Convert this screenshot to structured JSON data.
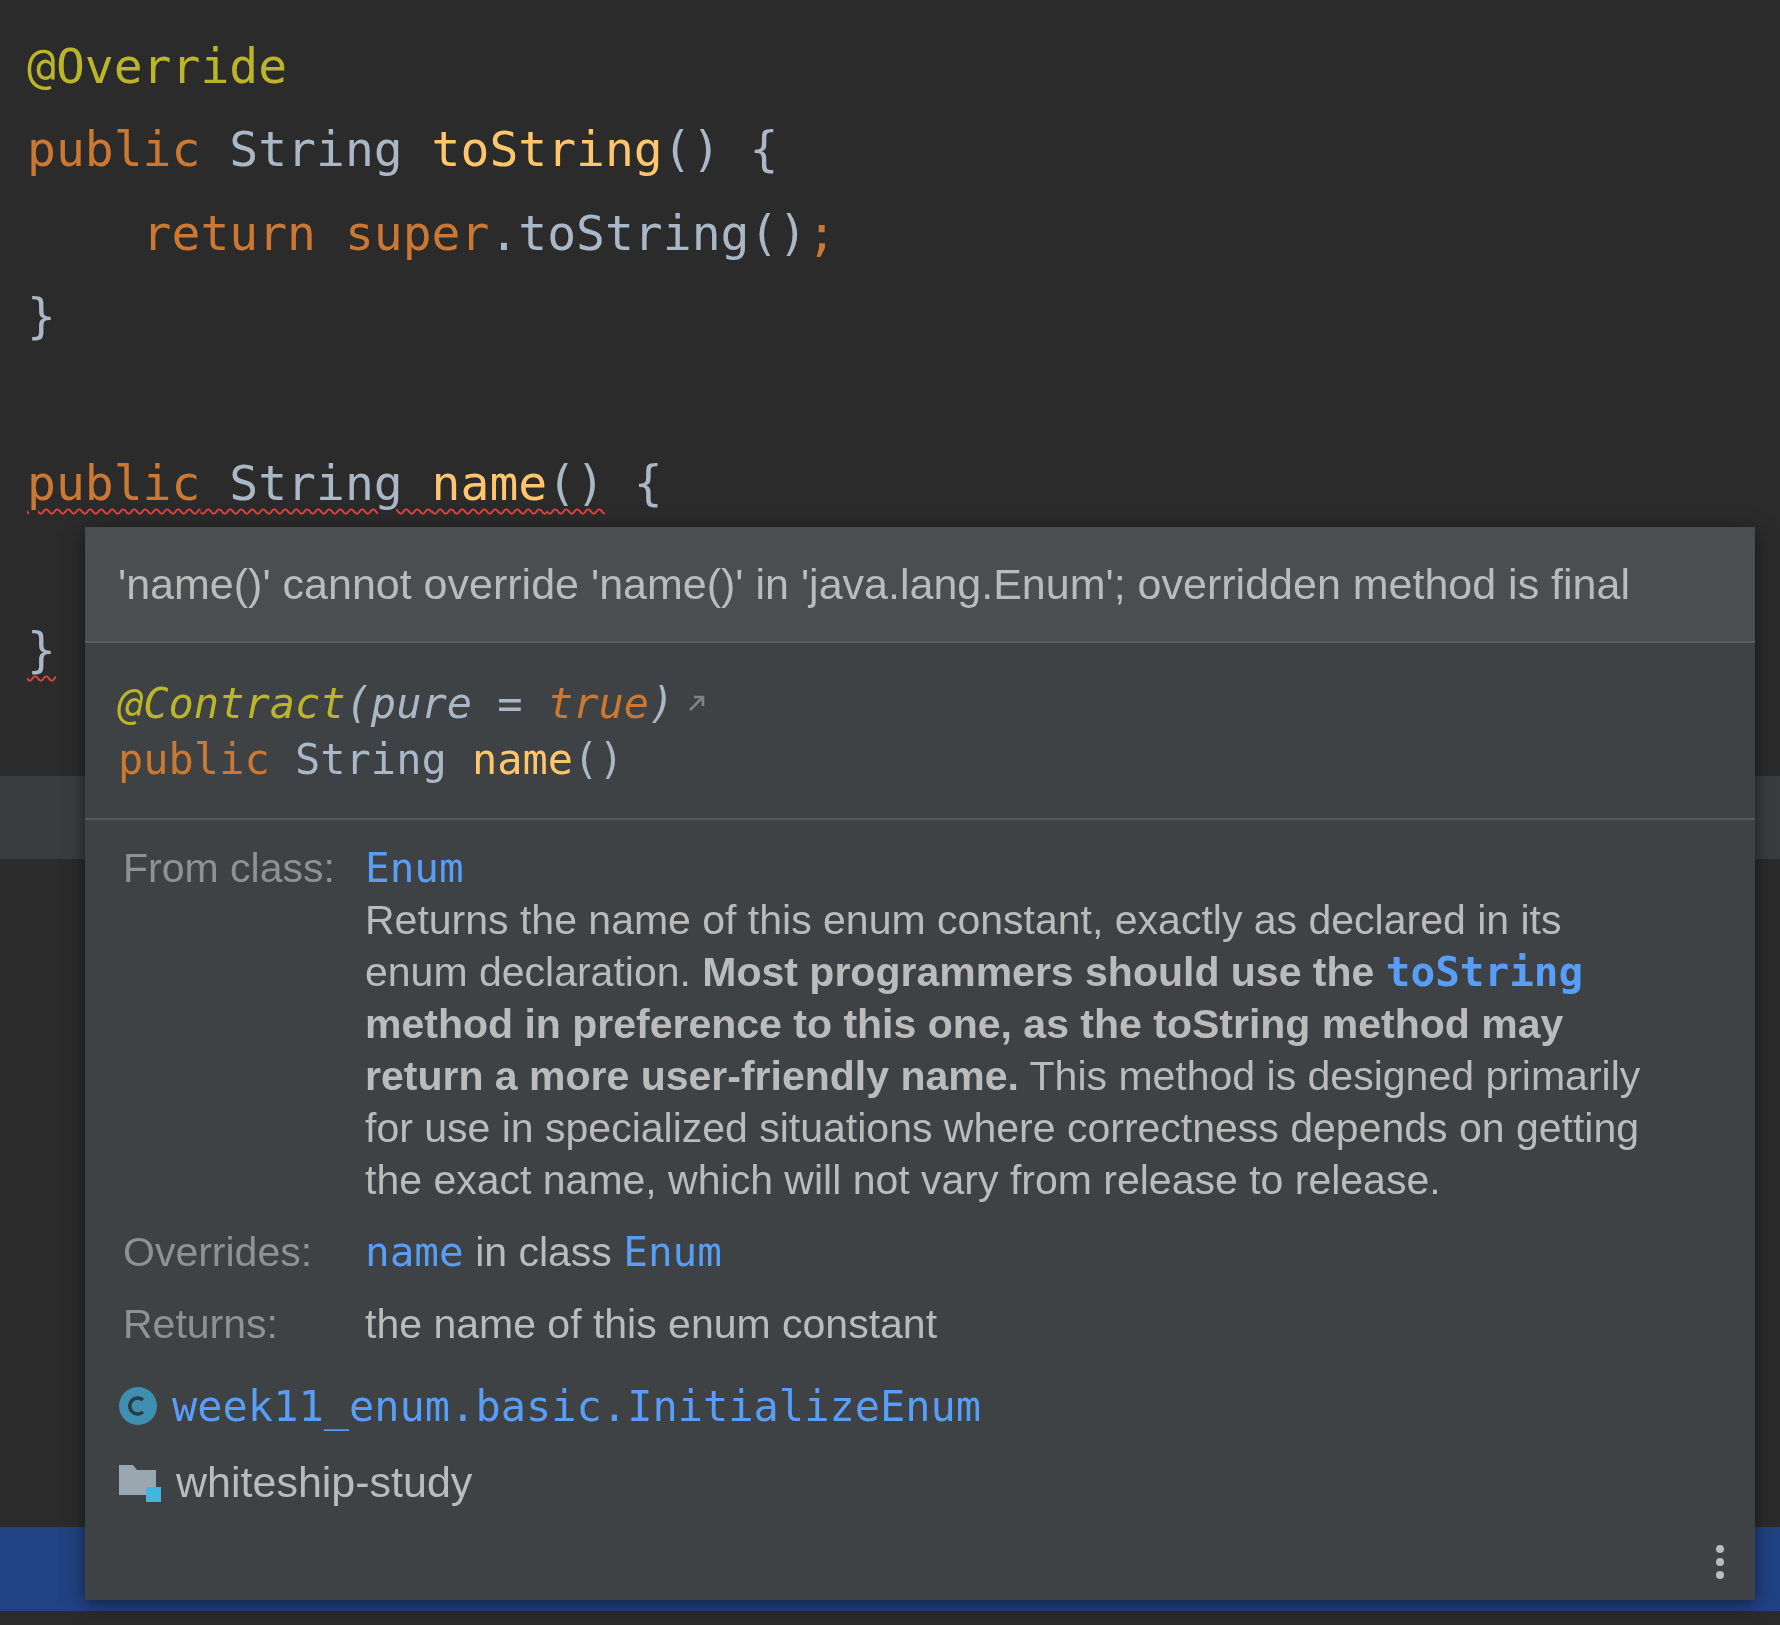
{
  "editor": {
    "lines": [
      {
        "current": false,
        "selected": false,
        "tokens": [
          {
            "text": "@Override",
            "kind": "annotation",
            "error": false
          }
        ]
      },
      {
        "current": false,
        "selected": false,
        "tokens": [
          {
            "text": "public",
            "kind": "keyword",
            "error": false
          },
          {
            "text": " String ",
            "kind": "type",
            "error": false
          },
          {
            "text": "toString",
            "kind": "method",
            "error": false
          },
          {
            "text": "() {",
            "kind": "plain",
            "error": false
          }
        ]
      },
      {
        "current": false,
        "selected": false,
        "tokens": [
          {
            "text": "    return super",
            "kind": "keyword",
            "error": false
          },
          {
            "text": ".toString()",
            "kind": "plain",
            "error": false
          },
          {
            "text": ";",
            "kind": "keyword",
            "error": false
          }
        ]
      },
      {
        "current": false,
        "selected": false,
        "tokens": [
          {
            "text": "}",
            "kind": "plain",
            "error": false
          }
        ]
      },
      {
        "current": false,
        "selected": false
      },
      {
        "current": false,
        "selected": false,
        "tokens": [
          {
            "text": "public",
            "kind": "keyword",
            "error": true
          },
          {
            "text": " String ",
            "kind": "type",
            "error": true
          },
          {
            "text": "name",
            "kind": "method",
            "error": true
          },
          {
            "text": "()",
            "kind": "plain",
            "error": true
          },
          {
            "text": " {",
            "kind": "plain",
            "error": false
          }
        ]
      },
      {
        "current": false,
        "selected": false
      },
      {
        "current": false,
        "selected": false,
        "tokens": [
          {
            "text": "}",
            "kind": "plain",
            "error": true
          }
        ]
      },
      {
        "current": false,
        "selected": false
      },
      {
        "current": true,
        "selected": false
      },
      {
        "current": false,
        "selected": false
      },
      {
        "current": false,
        "selected": false
      },
      {
        "current": false,
        "selected": false
      },
      {
        "current": false,
        "selected": false
      },
      {
        "current": false,
        "selected": false
      },
      {
        "current": false,
        "selected": false
      },
      {
        "current": false,
        "selected": false
      },
      {
        "current": false,
        "selected": false
      },
      {
        "current": false,
        "selected": true
      },
      {
        "current": false,
        "selected": false
      }
    ]
  },
  "popup": {
    "error_message": "'name()' cannot override 'name()' in 'java.lang.Enum'; overridden method is final",
    "signature": [
      [
        {
          "text": "@Contract",
          "kind": "annotation"
        },
        {
          "text": "(pure = ",
          "kind": "plain"
        },
        {
          "text": "true",
          "kind": "keyword"
        },
        {
          "text": ")",
          "kind": "plain"
        }
      ],
      [
        {
          "text": "public",
          "kind": "keyword"
        },
        {
          "text": " String ",
          "kind": "type"
        },
        {
          "text": "name",
          "kind": "method"
        },
        {
          "text": "()",
          "kind": "plain"
        }
      ]
    ],
    "sections": [
      {
        "label": "From class:",
        "blocks": [
          [
            {
              "text": "Enum",
              "kind": "code_link"
            }
          ],
          [
            {
              "text": "Returns the name of this enum constant, exactly as declared in its enum declaration. ",
              "kind": "plain"
            },
            {
              "text": "Most programmers should use the ",
              "kind": "bold"
            },
            {
              "text": "toString",
              "kind": "bold_code_link"
            },
            {
              "text": " method in preference to this one, as the toString method may return a more user-friendly name.",
              "kind": "bold"
            },
            {
              "text": " This method is designed primarily for use in specialized situations where correctness depends on getting the exact name, which will not vary from release to release.",
              "kind": "plain"
            }
          ]
        ]
      },
      {
        "label": "Overrides:",
        "blocks": [
          [
            {
              "text": "name",
              "kind": "code_link"
            },
            {
              "text": " in class ",
              "kind": "plain"
            },
            {
              "text": "Enum",
              "kind": "code_link"
            }
          ]
        ]
      },
      {
        "label": "Returns:",
        "blocks": [
          [
            {
              "text": "the name of this enum constant",
              "kind": "plain"
            }
          ]
        ]
      }
    ],
    "class_name": "week11_enum.basic.InitializeEnum",
    "module_name": "whiteship-study"
  }
}
